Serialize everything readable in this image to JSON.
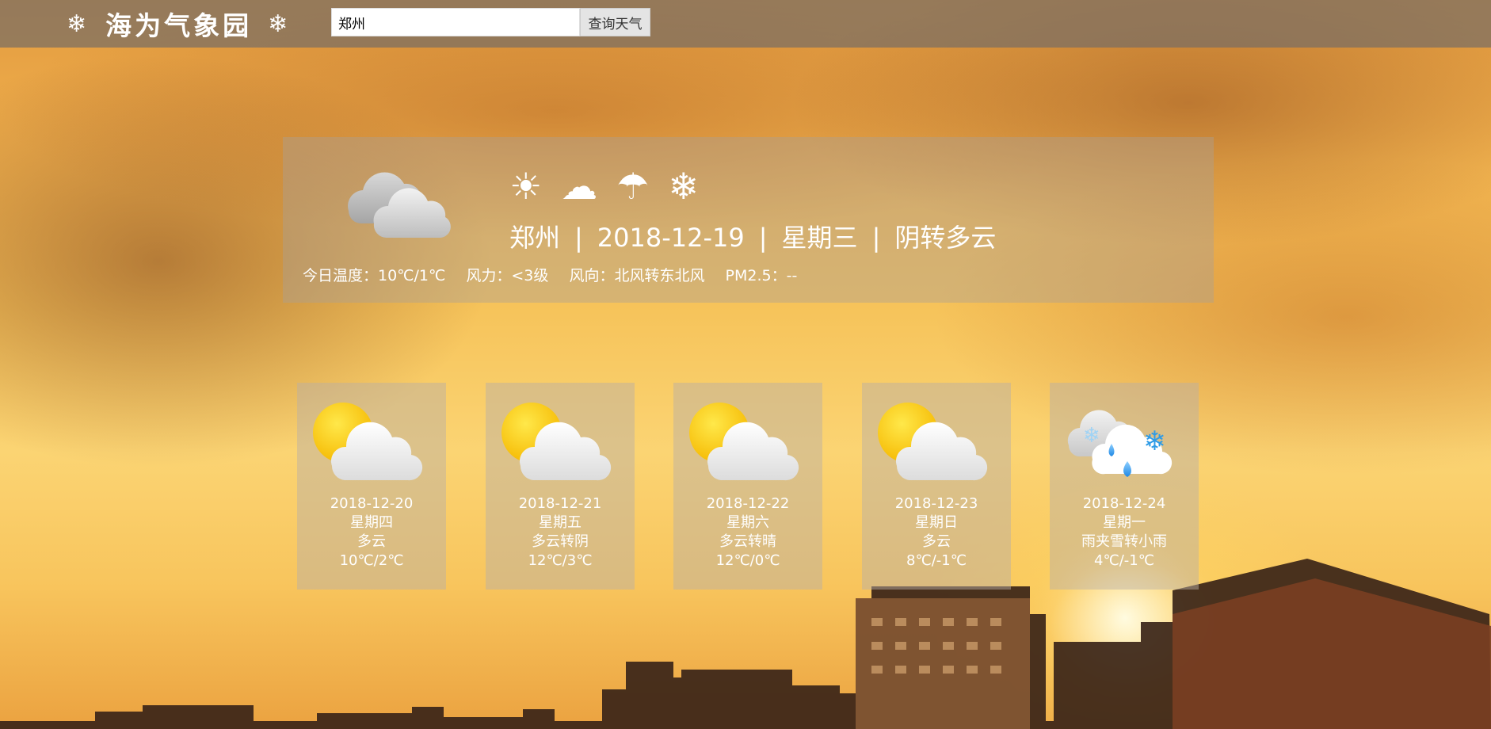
{
  "header": {
    "logo_text": "海为气象园",
    "logo_icon_left": "❄",
    "logo_icon_right": "❄",
    "search_value": "郑州",
    "search_button_label": "查询天气"
  },
  "today": {
    "weather_icon": "cloudy-icon",
    "condition_icons": [
      "☀",
      "☁",
      "☂",
      "❄"
    ],
    "city": "郑州",
    "date": "2018-12-19",
    "weekday": "星期三",
    "condition": "阴转多云",
    "separator": "|",
    "temperature": "今日温度：10℃/1℃",
    "wind_power": "风力：<3级",
    "wind_direction": "风向：北风转东北风",
    "pm25": "PM2.5：--"
  },
  "forecast": [
    {
      "date": "2018-12-20",
      "weekday": "星期四",
      "condition": "多云",
      "temp": "10℃/2℃",
      "icon": "partly-cloudy-icon"
    },
    {
      "date": "2018-12-21",
      "weekday": "星期五",
      "condition": "多云转阴",
      "temp": "12℃/3℃",
      "icon": "partly-cloudy-icon"
    },
    {
      "date": "2018-12-22",
      "weekday": "星期六",
      "condition": "多云转晴",
      "temp": "12℃/0℃",
      "icon": "partly-cloudy-icon"
    },
    {
      "date": "2018-12-23",
      "weekday": "星期日",
      "condition": "多云",
      "temp": "8℃/-1℃",
      "icon": "partly-cloudy-icon"
    },
    {
      "date": "2018-12-24",
      "weekday": "星期一",
      "condition": "雨夹雪转小雨",
      "temp": "4℃/-1℃",
      "icon": "sleet-icon"
    }
  ]
}
